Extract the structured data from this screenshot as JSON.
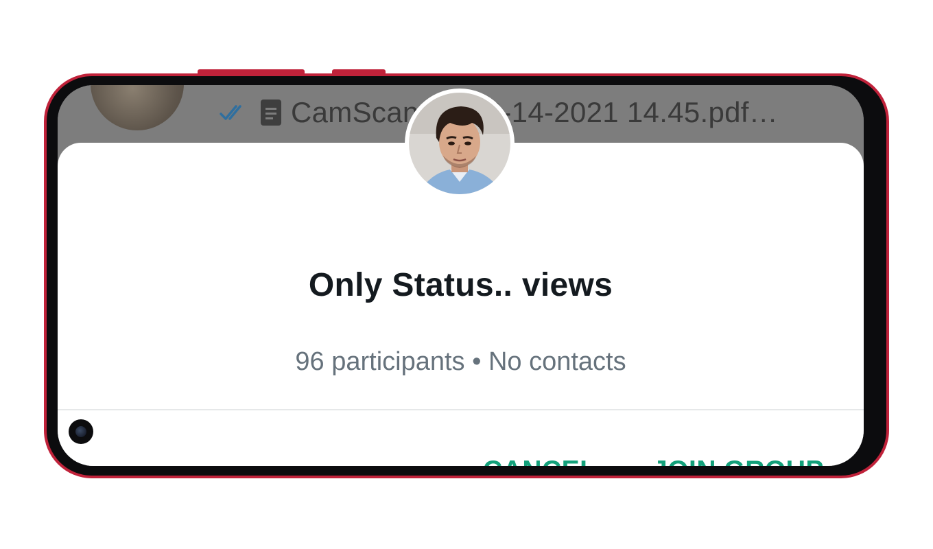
{
  "background_chat": {
    "filename_text": "CamScanner 12-14-2021 14.45.pdf…",
    "read_receipt_icon": "double-check-icon",
    "attachment_icon": "document-icon"
  },
  "dialog": {
    "group_name": "Only Status.. views",
    "meta": "96 participants • No contacts",
    "avatar_icon": "group-avatar",
    "cancel_label": "CANCEL",
    "join_label": "JOIN GROUP"
  },
  "colors": {
    "accent": "#12a07a",
    "phone_frame": "#c0223a",
    "title_text": "#141a1f",
    "meta_text": "#66727c",
    "read_ticks": "#2f6f9f"
  }
}
